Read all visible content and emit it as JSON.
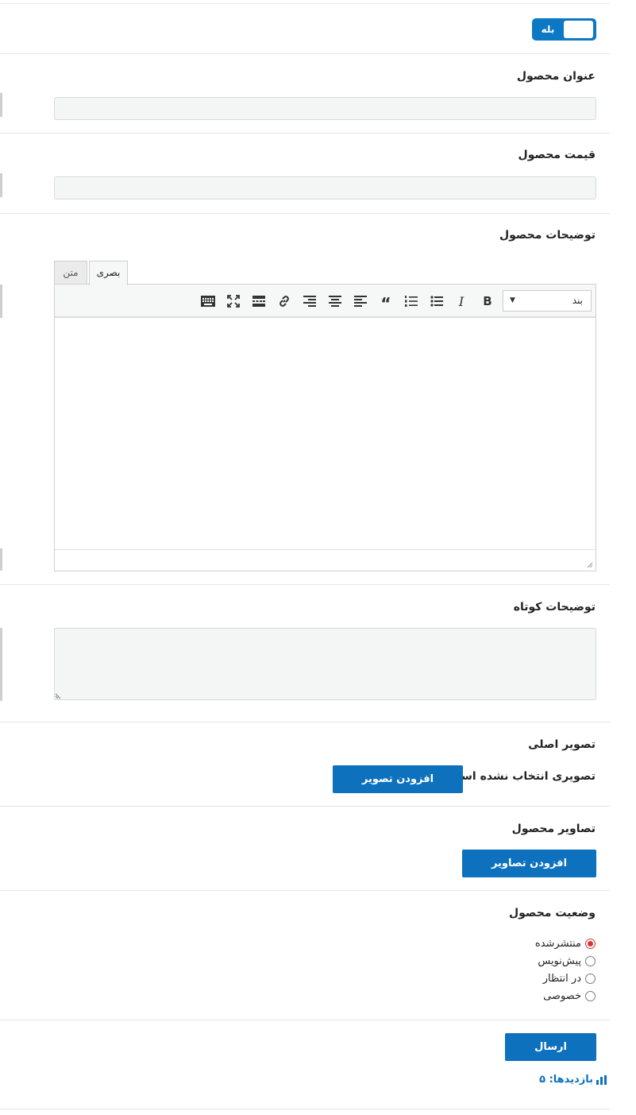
{
  "toggle": {
    "label": "بله"
  },
  "fields": {
    "title_label": "عنوان محصول",
    "title_value": "",
    "price_label": "قیمت محصول",
    "price_value": "",
    "description_label": "توضیحات محصول",
    "short_description_label": "توضیحات کوتاه",
    "short_description_value": ""
  },
  "editor": {
    "tabs": [
      {
        "label": "بصری",
        "active": true
      },
      {
        "label": "متن",
        "active": false
      }
    ],
    "format_value": "بند",
    "tools": [
      "bold-icon",
      "italic-icon",
      "bullet-list-icon",
      "numbered-list-icon",
      "blockquote-icon",
      "align-left-icon",
      "align-center-icon",
      "align-right-icon",
      "link-icon",
      "read-more-icon",
      "fullscreen-icon",
      "toolbar-toggle-icon"
    ],
    "bold_glyph": "B",
    "italic_glyph": "I",
    "quote_glyph": "“"
  },
  "main_image": {
    "label": "تصویر اصلی",
    "status": "تصویری انتخاب نشده است",
    "button": "افزودن تصویر"
  },
  "gallery": {
    "label": "تصاویر محصول",
    "button": "افزودن تصاویر"
  },
  "status": {
    "label": "وضعیت محصول",
    "options": [
      {
        "label": "منتشرشده",
        "checked": true
      },
      {
        "label": "پیش‌نویس",
        "checked": false
      },
      {
        "label": "در انتظار",
        "checked": false
      },
      {
        "label": "خصوصی",
        "checked": false
      }
    ]
  },
  "submit": {
    "label": "ارسال"
  },
  "views": {
    "text": "بازدیدها: ۵"
  },
  "colors": {
    "accent": "#0d71bd",
    "toggle": "#0d79c4",
    "radio_checked": "#d63638",
    "field_bg": "#f4f5f5"
  }
}
